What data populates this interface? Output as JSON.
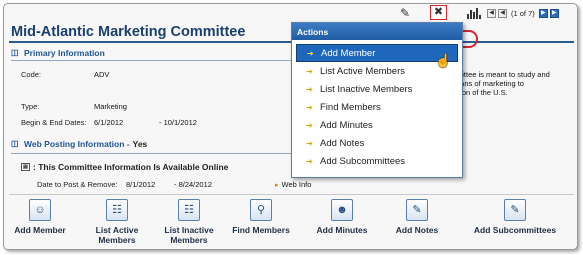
{
  "toolbar": {
    "pencil_icon": "pencil-icon",
    "tools_icon": "tools-icon",
    "chart_icon": "bar-chart-icon",
    "pager_text": "(1 of 7)"
  },
  "committee": {
    "title": "Mid-Atlantic Marketing Committee"
  },
  "primary_info": {
    "heading": "Primary Information",
    "code_label": "Code:",
    "code_value": "ADV",
    "type_label": "Type:",
    "type_value": "Marketing",
    "dates_label": "Begin & End Dates:",
    "begin_date": "6/1/2012",
    "end_date": "- 10/1/2012",
    "description_lines": [
      "mittee is meant to study and",
      "eans of marketing to",
      "gion of the U.S."
    ]
  },
  "web_posting": {
    "heading": "Web Posting Information -",
    "value": "Yes",
    "online_text": ": This Committee Information Is Available Online",
    "date_label": "Date to Post & Remove:",
    "post_date": "8/1/2012",
    "remove_date": "- 8/24/2012",
    "web_info_label": "Web Info"
  },
  "actions_menu": {
    "header": "Actions",
    "items": [
      "Add Member",
      "List Active Members",
      "List Inactive Members",
      "Find Members",
      "Add Minutes",
      "Add Notes",
      "Add Subcommittees"
    ]
  },
  "actions_bar": [
    {
      "label": "Add Member",
      "icon": "add-member-icon"
    },
    {
      "label": "List Active Members",
      "icon": "list-active-members-icon"
    },
    {
      "label": "List Inactive Members",
      "icon": "list-inactive-members-icon"
    },
    {
      "label": "Find Members",
      "icon": "find-members-icon"
    },
    {
      "label": "Add Minutes",
      "icon": "add-minutes-icon"
    },
    {
      "label": "Add Notes",
      "icon": "add-notes-icon"
    },
    {
      "label": "Add Subcommittees",
      "icon": "add-subcommittees-icon"
    }
  ],
  "colors": {
    "accent": "#1f5597",
    "menu_header": "#2a6fb8",
    "highlight": "#d9232e"
  }
}
